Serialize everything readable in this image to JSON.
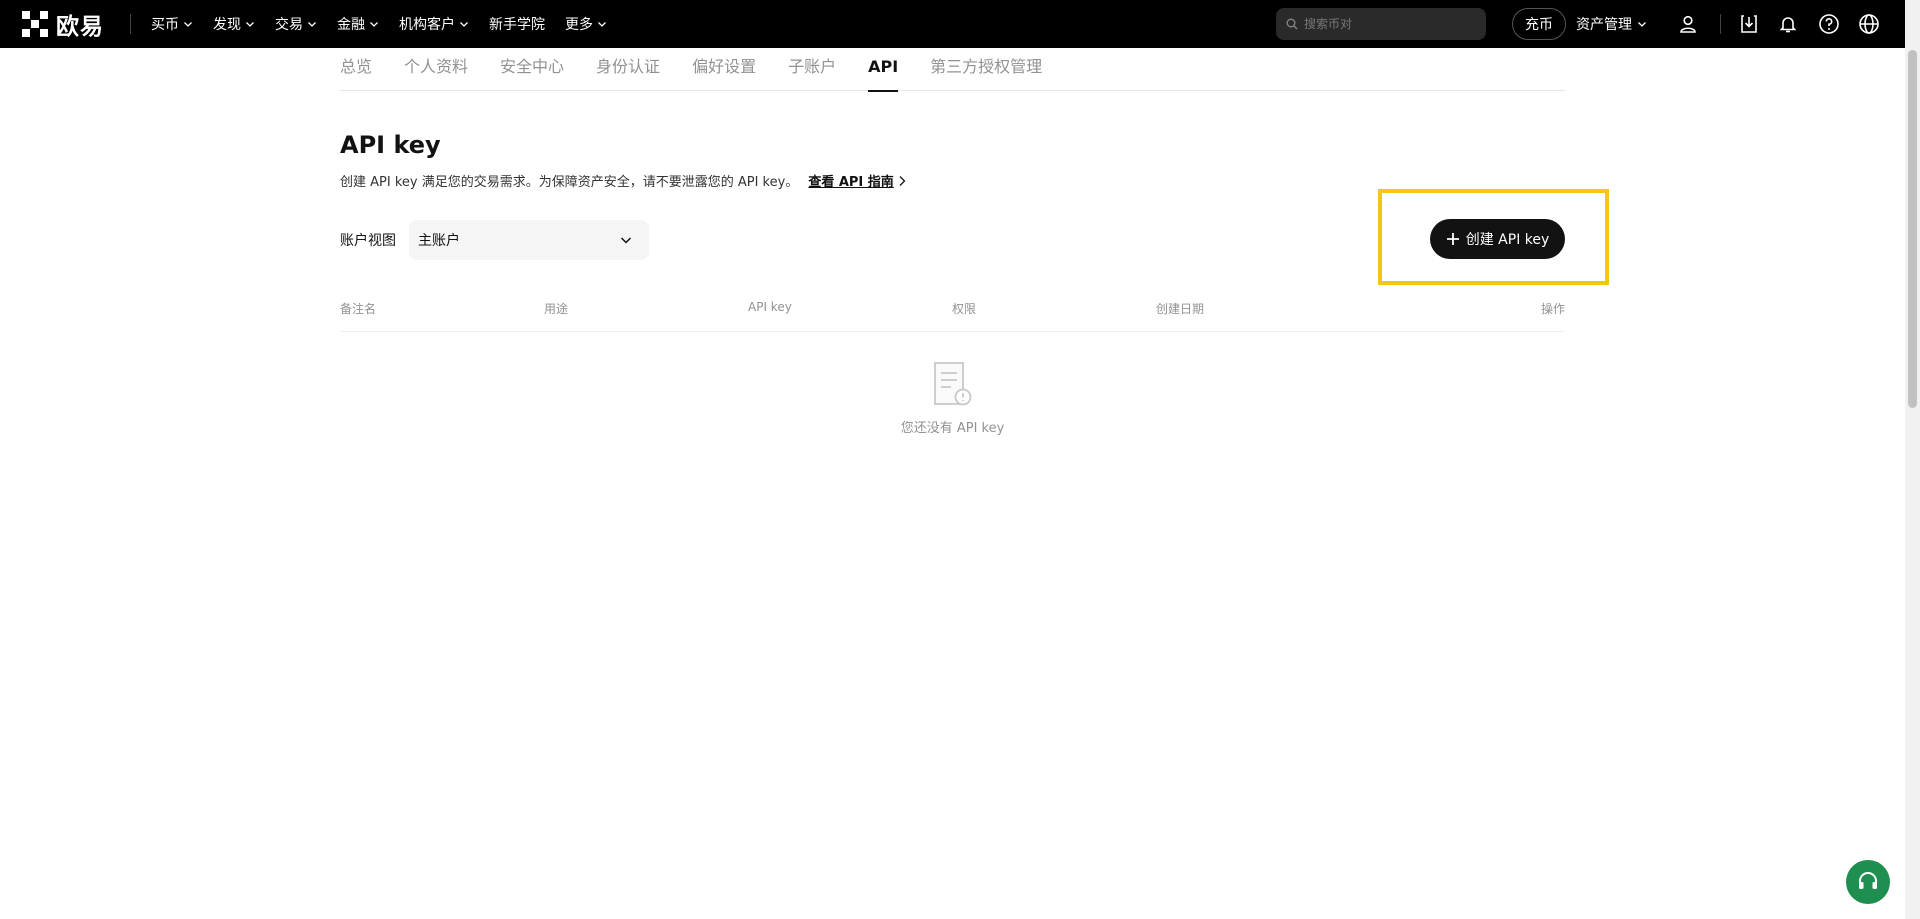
{
  "brand": {
    "name": "欧易",
    "accent": "#121212",
    "highlight": "#f5c518",
    "support_color": "#1f8f4f"
  },
  "topnav": {
    "items": [
      {
        "label": "买币",
        "has_dropdown": true
      },
      {
        "label": "发现",
        "has_dropdown": true
      },
      {
        "label": "交易",
        "has_dropdown": true
      },
      {
        "label": "金融",
        "has_dropdown": true
      },
      {
        "label": "机构客户",
        "has_dropdown": true
      },
      {
        "label": "新手学院",
        "has_dropdown": false
      },
      {
        "label": "更多",
        "has_dropdown": true
      }
    ],
    "search_placeholder": "搜索币对",
    "deposit_label": "充币",
    "asset_mgmt_label": "资产管理",
    "icons": [
      "user-icon",
      "download-icon",
      "bell-icon",
      "help-icon",
      "globe-icon"
    ]
  },
  "tabs": [
    {
      "label": "总览",
      "active": false
    },
    {
      "label": "个人资料",
      "active": false
    },
    {
      "label": "安全中心",
      "active": false
    },
    {
      "label": "身份认证",
      "active": false
    },
    {
      "label": "偏好设置",
      "active": false
    },
    {
      "label": "子账户",
      "active": false
    },
    {
      "label": "API",
      "active": true
    },
    {
      "label": "第三方授权管理",
      "active": false
    }
  ],
  "main": {
    "title": "API key",
    "description": "创建 API key 满足您的交易需求。为保障资产安全，请不要泄露您的 API key。",
    "guide_link": "查看 API 指南",
    "account_view_label": "账户视图",
    "account_selected": "主账户",
    "create_button": "创建 API key"
  },
  "table": {
    "columns": [
      "备注名",
      "用途",
      "API key",
      "权限",
      "创建日期",
      "操作"
    ],
    "rows": [],
    "empty_text": "您还没有 API key"
  }
}
